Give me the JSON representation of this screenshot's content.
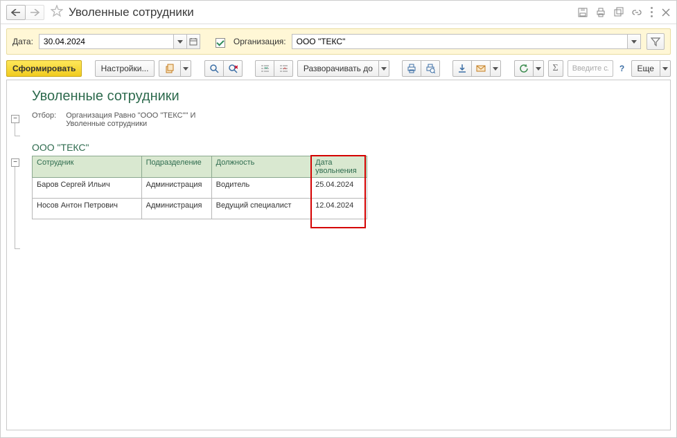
{
  "header": {
    "title": "Уволенные сотрудники"
  },
  "filter": {
    "date_label": "Дата:",
    "date_value": "30.04.2024",
    "org_label": "Организация:",
    "org_value": "ООО \"ТЕКС\""
  },
  "toolbar": {
    "generate": "Сформировать",
    "settings": "Настройки...",
    "expand": "Разворачивать до",
    "more": "Еще",
    "search_placeholder": "Введите сл..."
  },
  "report": {
    "title": "Уволенные сотрудники",
    "filter_caption": "Отбор:",
    "filter_text_line1": "Организация Равно \"ООО \"ТЕКС\"\" И",
    "filter_text_line2": "Уволенные сотрудники",
    "org_name": "ООО \"ТЕКС\"",
    "columns": {
      "employee": "Сотрудник",
      "department": "Подразделение",
      "position": "Должность",
      "dismissal_date": "Дата увольнения"
    },
    "rows": [
      {
        "employee": "Баров Сергей Ильич",
        "department": "Администрация",
        "position": "Водитель",
        "dismissal_date": "25.04.2024"
      },
      {
        "employee": "Носов Антон Петрович",
        "department": "Администрация",
        "position": "Ведущий специалист",
        "dismissal_date": "12.04.2024"
      }
    ]
  }
}
